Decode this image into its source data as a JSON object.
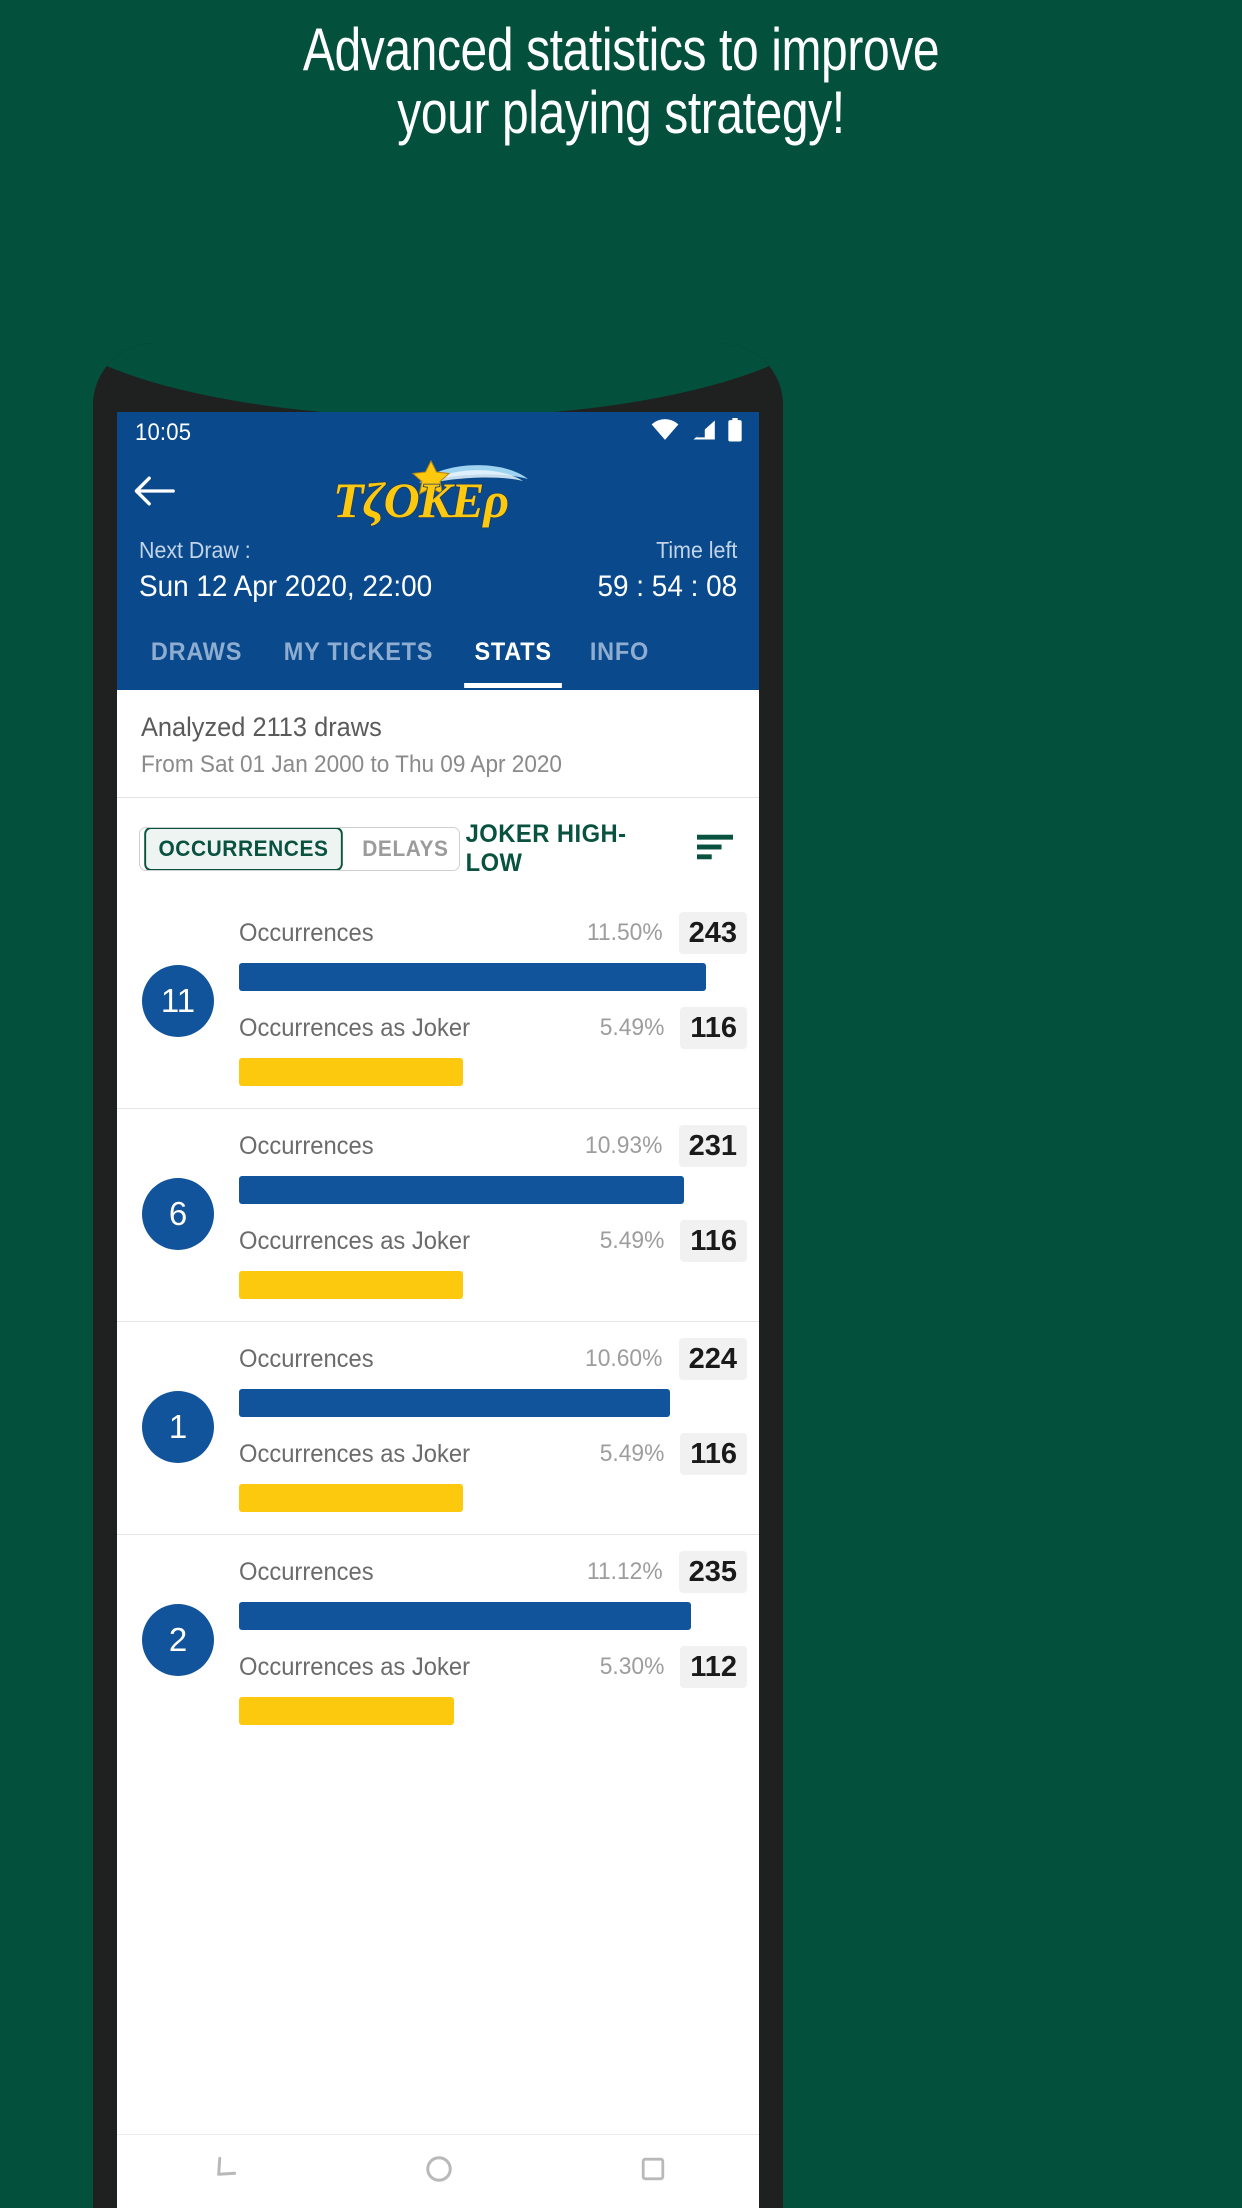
{
  "promo": {
    "headline_line1": "Advanced statistics to improve",
    "headline_line2": "your playing strategy!"
  },
  "colors": {
    "background": "#03503c",
    "app_bar_blue": "#0a4a8c",
    "bar_blue": "#12549b",
    "bar_yellow": "#fdc90f",
    "accent_green": "#0a5240"
  },
  "status_bar": {
    "time": "10:05",
    "icons": [
      "wifi-icon",
      "signal-icon",
      "battery-icon"
    ]
  },
  "app_bar": {
    "back_icon": "back-arrow-icon",
    "logo_text": "ΤΖΟΚΕΡ"
  },
  "draw_info": {
    "next_draw_label": "Next Draw :",
    "next_draw_value": "Sun 12 Apr 2020, 22:00",
    "time_left_label": "Time left",
    "time_left_value": "59 : 54 : 08"
  },
  "tabs": [
    {
      "label": "DRAWS",
      "active": false
    },
    {
      "label": "MY TICKETS",
      "active": false
    },
    {
      "label": "STATS",
      "active": true
    },
    {
      "label": "INFO",
      "active": false
    }
  ],
  "analysis": {
    "title": "Analyzed 2113 draws",
    "subtitle": "From Sat 01 Jan 2000 to Thu 09 Apr 2020"
  },
  "filters": {
    "segments": [
      {
        "label": "OCCURRENCES",
        "active": true
      },
      {
        "label": "DELAYS",
        "active": false
      }
    ],
    "sort_label": "JOKER HIGH-LOW",
    "sort_icon": "sort-descending-icon"
  },
  "chart_data": {
    "type": "bar",
    "title": "Analyzed 2113 draws",
    "xlabel": "",
    "ylabel": "",
    "categories": [
      "11",
      "6",
      "1",
      "2"
    ],
    "series": [
      {
        "name": "Occurrences",
        "color": "#12549b",
        "values": [
          243,
          231,
          224,
          235
        ],
        "percents": [
          "11.50%",
          "10.93%",
          "10.60%",
          "11.12%"
        ]
      },
      {
        "name": "Occurrences as Joker",
        "color": "#fdc90f",
        "values": [
          116,
          116,
          116,
          112
        ],
        "percents": [
          "5.49%",
          "5.49%",
          "5.49%",
          "5.30%"
        ]
      }
    ],
    "ylim": [
      0,
      2113
    ],
    "grid": false,
    "legend": "none"
  },
  "rows": [
    {
      "number": "11",
      "occ_label": "Occurrences",
      "occ_pct": "11.50%",
      "occ_count": "243",
      "occ_width": "92%",
      "joker_label": "Occurrences as Joker",
      "joker_pct": "5.49%",
      "joker_count": "116",
      "joker_width": "44%"
    },
    {
      "number": "6",
      "occ_label": "Occurrences",
      "occ_pct": "10.93%",
      "occ_count": "231",
      "occ_width": "87.5%",
      "joker_label": "Occurrences as Joker",
      "joker_pct": "5.49%",
      "joker_count": "116",
      "joker_width": "44%"
    },
    {
      "number": "1",
      "occ_label": "Occurrences",
      "occ_pct": "10.60%",
      "occ_count": "224",
      "occ_width": "84.8%",
      "joker_label": "Occurrences as Joker",
      "joker_pct": "5.49%",
      "joker_count": "116",
      "joker_width": "44%"
    },
    {
      "number": "2",
      "occ_label": "Occurrences",
      "occ_pct": "11.12%",
      "occ_count": "235",
      "occ_width": "89%",
      "joker_label": "Occurrences as Joker",
      "joker_pct": "5.30%",
      "joker_count": "112",
      "joker_width": "42.4%"
    }
  ],
  "nav_bar": {
    "back": "nav-back-icon",
    "home": "nav-home-icon",
    "recents": "nav-recents-icon"
  }
}
